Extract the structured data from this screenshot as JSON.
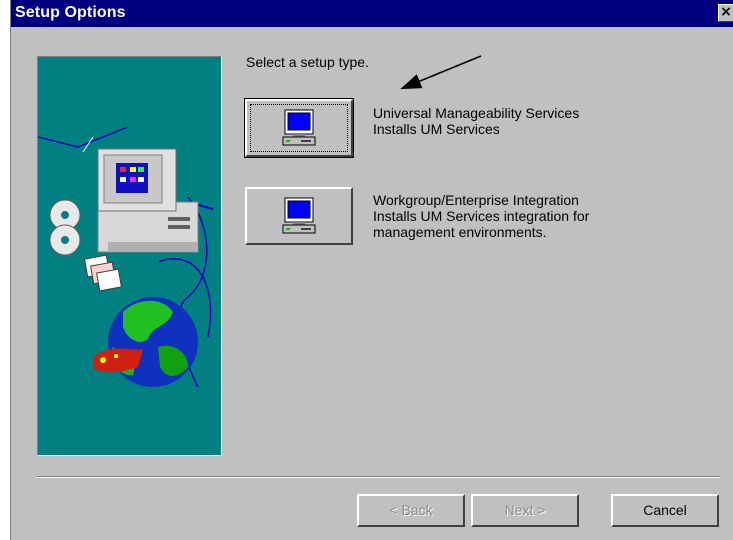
{
  "window": {
    "title": "Setup Options",
    "close_glyph": "×"
  },
  "prompt": "Select a setup type.",
  "options": [
    {
      "title": "Universal Manageability Services",
      "desc": "Installs UM Services",
      "icon": "computer-icon",
      "selected": true
    },
    {
      "title": "Workgroup/Enterprise Integration",
      "desc": "Installs UM Services integration for",
      "desc2": "management environments.",
      "icon": "computer-icon",
      "selected": false
    }
  ],
  "buttons": {
    "back": "< Back",
    "next": "Next >",
    "cancel": "Cancel"
  },
  "colors": {
    "titlebar": "#000080",
    "art_background": "#008080",
    "dialog": "#c0c0c0"
  }
}
